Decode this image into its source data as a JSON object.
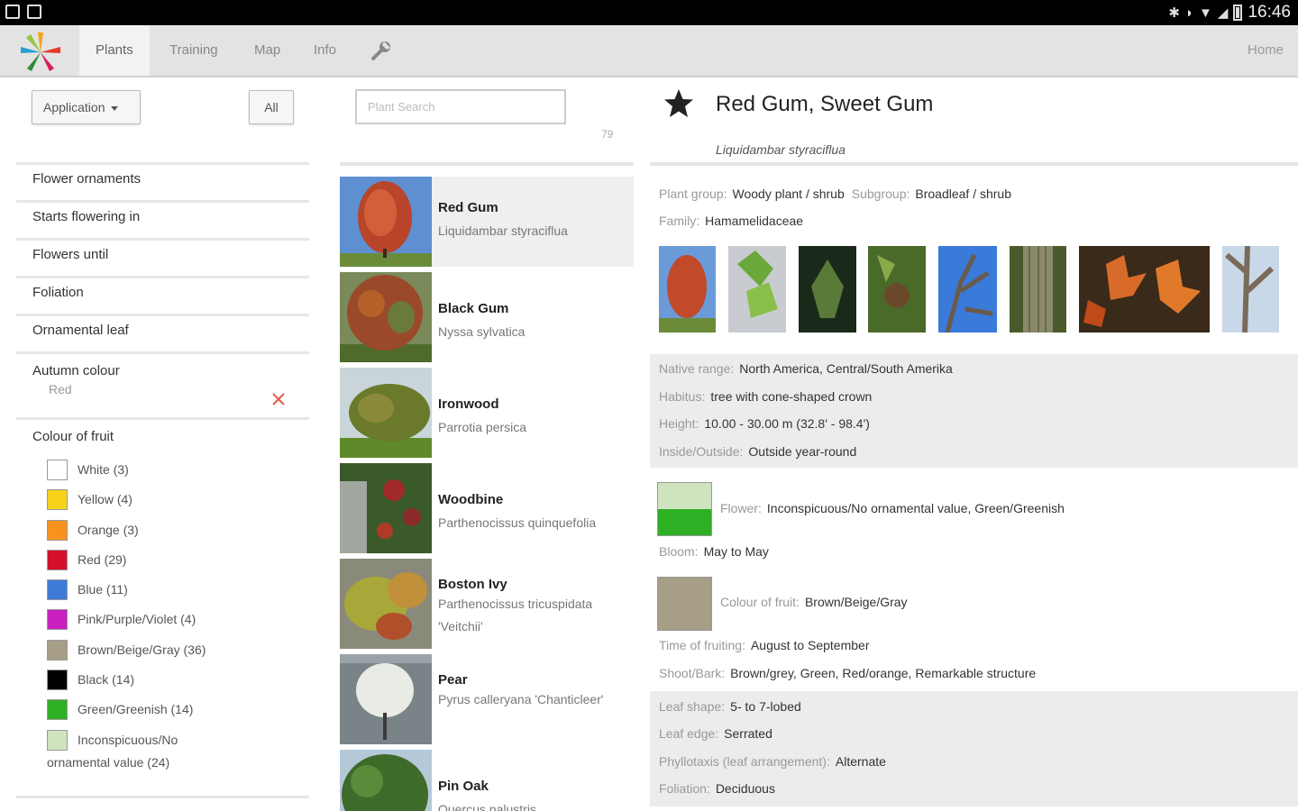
{
  "status": {
    "time": "16:46"
  },
  "nav": {
    "tabs": [
      {
        "label": "Plants",
        "active": true
      },
      {
        "label": "Training"
      },
      {
        "label": "Map"
      },
      {
        "label": "Info"
      }
    ],
    "home": "Home"
  },
  "filters": {
    "application_label": "Application",
    "all_label": "All",
    "items": [
      "Flower ornaments",
      "Starts flowering in",
      "Flowers until",
      "Foliation",
      "Ornamental leaf"
    ],
    "autumn": {
      "label": "Autumn colour",
      "value": "Red"
    },
    "fruit_title": "Colour of fruit",
    "fruit_colours": [
      {
        "label": "White (3)",
        "color": "#ffffff"
      },
      {
        "label": "Yellow (4)",
        "color": "#f7d21a"
      },
      {
        "label": "Orange (3)",
        "color": "#f7921e"
      },
      {
        "label": "Red (29)",
        "color": "#d4112a"
      },
      {
        "label": "Blue (11)",
        "color": "#3d7bd6"
      },
      {
        "label": "Pink/Purple/Violet (4)",
        "color": "#c81fbe"
      },
      {
        "label": "Brown/Beige/Gray (36)",
        "color": "#a69e87"
      },
      {
        "label": "Black (14)",
        "color": "#000000"
      },
      {
        "label": "Green/Greenish (14)",
        "color": "#2fb024"
      },
      {
        "label": "Inconspicuous/No",
        "label2": "ornamental value (24)",
        "color": "#cfe3bf"
      }
    ]
  },
  "list": {
    "search_placeholder": "Plant Search",
    "count": "79",
    "items": [
      {
        "name": "Red Gum",
        "sci": "Liquidambar styraciflua",
        "selected": true
      },
      {
        "name": "Black Gum",
        "sci": "Nyssa sylvatica"
      },
      {
        "name": "Ironwood",
        "sci": "Parrotia persica"
      },
      {
        "name": "Woodbine",
        "sci": "Parthenocissus quinquefolia"
      },
      {
        "name": "Boston Ivy",
        "sci": "Parthenocissus tricuspidata 'Veitchii'"
      },
      {
        "name": "Pear",
        "sci": "Pyrus calleryana 'Chanticleer'"
      },
      {
        "name": "Pin Oak",
        "sci": "Quercus palustris"
      }
    ]
  },
  "detail": {
    "title": "Red Gum, Sweet Gum",
    "sci": "Liquidambar styraciflua",
    "plant_group_k": "Plant group:",
    "plant_group_v": "Woody plant / shrub",
    "subgroup_k": "Subgroup:",
    "subgroup_v": "Broadleaf / shrub",
    "family_k": "Family:",
    "family_v": "Hamamelidaceae",
    "native_k": "Native range:",
    "native_v": "North America, Central/South Amerika",
    "habitus_k": "Habitus:",
    "habitus_v": "tree with cone-shaped crown",
    "height_k": "Height:",
    "height_v": "10.00 - 30.00 m (32.8' - 98.4')",
    "inout_k": "Inside/Outside:",
    "inout_v": "Outside year-round",
    "flower_k": "Flower:",
    "flower_v": "Inconspicuous/No ornamental value, Green/Greenish",
    "bloom_k": "Bloom:",
    "bloom_v": "May to May",
    "fruitcol_k": "Colour of fruit:",
    "fruitcol_v": "Brown/Beige/Gray",
    "fruittime_k": "Time of fruiting:",
    "fruittime_v": "August to September",
    "shoot_k": "Shoot/Bark:",
    "shoot_v": "Brown/grey, Green, Red/orange, Remarkable structure",
    "leafshape_k": "Leaf shape:",
    "leafshape_v": "5- to 7-lobed",
    "leafedge_k": "Leaf edge:",
    "leafedge_v": "Serrated",
    "phyllo_k": "Phyllotaxis (leaf arrangement):",
    "phyllo_v": "Alternate",
    "foliation_k": "Foliation:",
    "foliation_v": "Deciduous",
    "colors": {
      "flower_top": "#cfe3bf",
      "flower_bottom": "#2fb024",
      "fruit": "#a69e87"
    }
  }
}
